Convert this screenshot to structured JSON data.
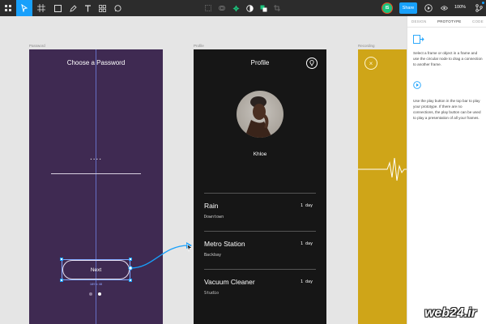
{
  "toolbar": {
    "avatar_initials": "IS",
    "share_label": "Share",
    "zoom_label": "100%",
    "icons": [
      "menu-icon",
      "move-tool-icon",
      "frame-tool-icon",
      "shape-tool-icon",
      "pen-tool-icon",
      "text-tool-icon",
      "components-icon",
      "comment-icon",
      "boolean-icon",
      "mask-icon",
      "component-icon",
      "theme-icon",
      "fill-icon",
      "crop-icon",
      "present-icon",
      "view-icon",
      "avatar"
    ]
  },
  "canvas": {
    "frame_labels": {
      "password": "Password",
      "profile": "Profile",
      "recording": "Recording"
    },
    "password_frame": {
      "title": "Choose a Password",
      "dots": "....",
      "next_label": "Next",
      "size_label": "189 x 48"
    },
    "profile_frame": {
      "title": "Profile",
      "name": "Khloe",
      "rows": [
        {
          "title": "Rain",
          "sub": "Downtown",
          "time": "1 day"
        },
        {
          "title": "Metro Station",
          "sub": "Backbay",
          "time": "1 day"
        },
        {
          "title": "Vacuum Cleaner",
          "sub": "Studio",
          "time": "1 day"
        }
      ]
    }
  },
  "panel": {
    "tabs": [
      "DESIGN",
      "PROTOTYPE",
      "CODE"
    ],
    "text_1": "Select a frame or object in a frame and use the circular node to drag a connection to another frame.",
    "text_2": "Use the play button in the top bar to play your prototype. If there are no connections, the play button can be used to play a presentation of all your frames."
  },
  "watermark": "web24.ir",
  "colors": {
    "accent": "#18a0fb",
    "password_bg": "#3f2a52",
    "profile_bg": "#161616",
    "recording_bg": "#cfa518",
    "toolbar_bg": "#2c2c2c"
  }
}
